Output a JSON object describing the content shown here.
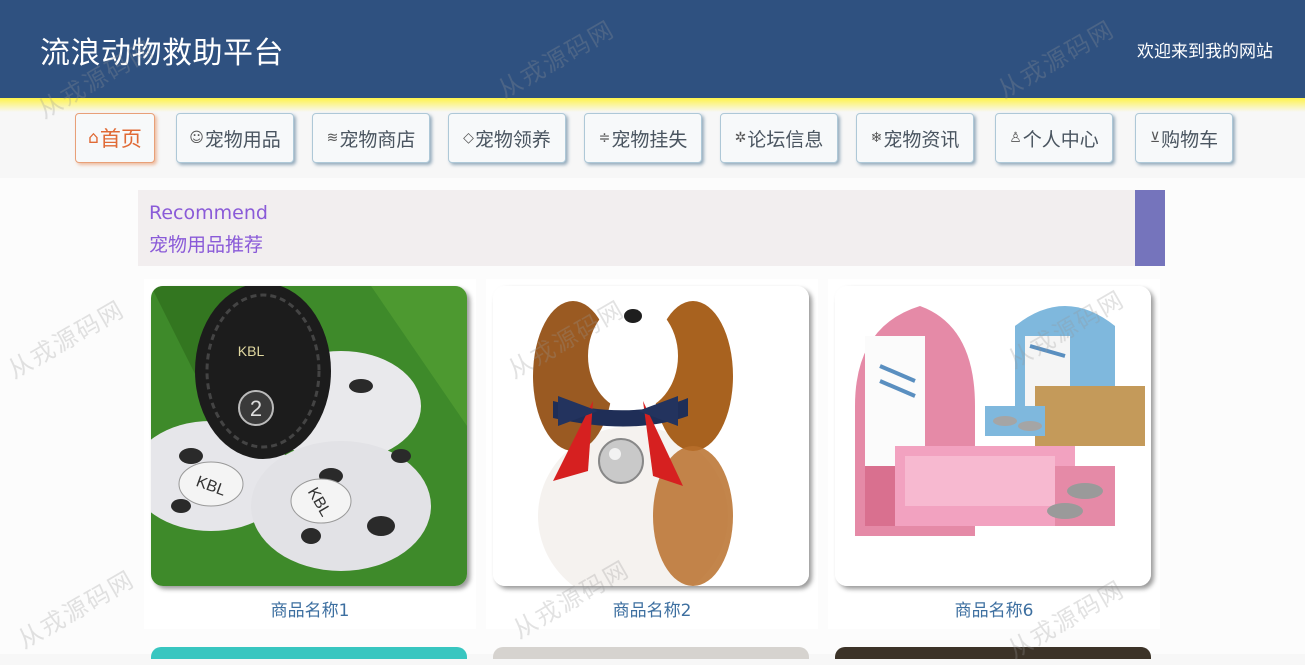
{
  "header": {
    "site_title": "流浪动物救助平台",
    "welcome": "欢迎来到我的网站",
    "background_color": "#2f5180"
  },
  "nav": {
    "items": [
      {
        "label": "首页",
        "icon": "home-icon",
        "glyph": "⌂",
        "active": true
      },
      {
        "label": "宠物用品",
        "icon": "palette-icon",
        "glyph": "☺",
        "active": false
      },
      {
        "label": "宠物商店",
        "icon": "layers-icon",
        "glyph": "≋",
        "active": false
      },
      {
        "label": "宠物领养",
        "icon": "tag-icon",
        "glyph": "◇",
        "active": false
      },
      {
        "label": "宠物挂失",
        "icon": "sliders-icon",
        "glyph": "≑",
        "active": false
      },
      {
        "label": "论坛信息",
        "icon": "settings-icon",
        "glyph": "✲",
        "active": false
      },
      {
        "label": "宠物资讯",
        "icon": "snowflake-icon",
        "glyph": "❄",
        "active": false
      },
      {
        "label": "个人中心",
        "icon": "user-icon",
        "glyph": "♙",
        "active": false
      },
      {
        "label": "购物车",
        "icon": "cart-icon",
        "glyph": "⊻",
        "active": false
      }
    ]
  },
  "recommend": {
    "title_en": "Recommend",
    "title_cn": "宠物用品推荐",
    "accent_color": "#7574bc"
  },
  "products": [
    {
      "name": "商品名称1",
      "image": "pet-shoes-image"
    },
    {
      "name": "商品名称2",
      "image": "dog-with-bell-image"
    },
    {
      "name": "商品名称6",
      "image": "pet-bed-furniture-image"
    }
  ],
  "watermark": "从戎源码网"
}
